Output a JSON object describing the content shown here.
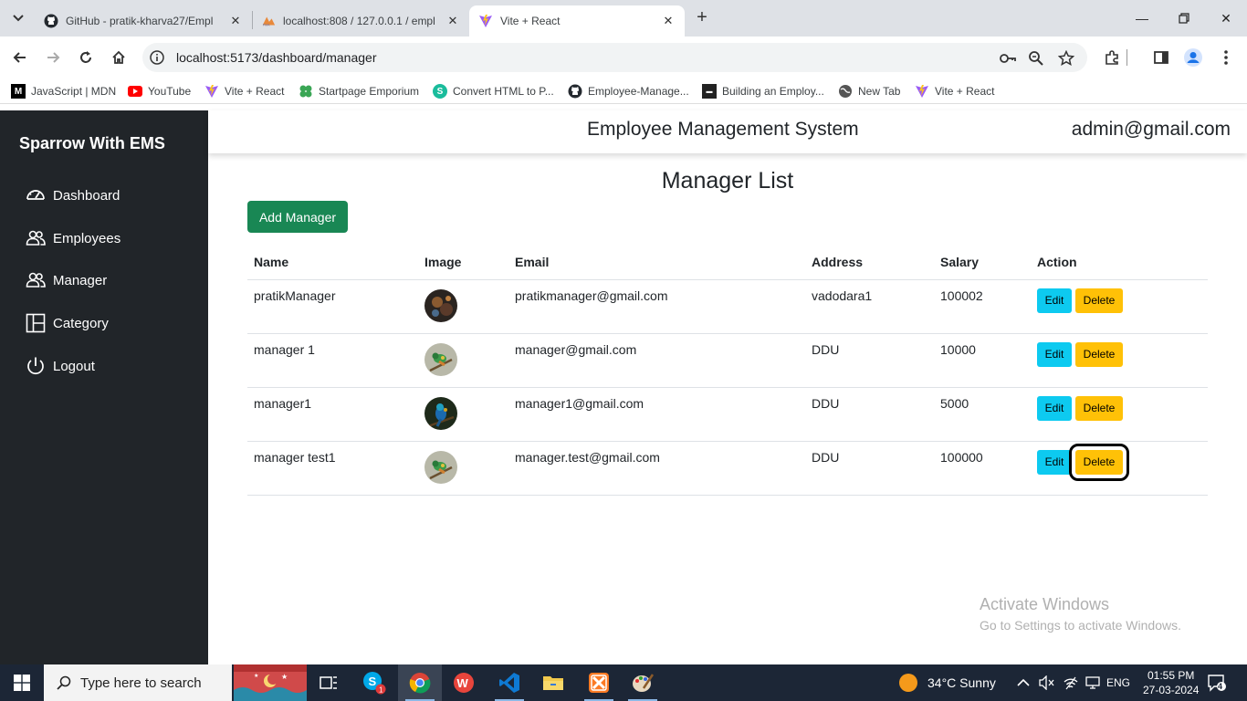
{
  "browser": {
    "tabs": [
      {
        "title": "GitHub - pratik-kharva27/Empl",
        "icon": "github-icon"
      },
      {
        "title": "localhost:808 / 127.0.0.1 / empl",
        "icon": "phpmyadmin-icon"
      },
      {
        "title": "Vite + React",
        "icon": "vite-icon",
        "active": true
      }
    ],
    "url": "localhost:5173/dashboard/manager",
    "bookmarks": [
      {
        "label": "JavaScript | MDN",
        "icon": "mdn-icon"
      },
      {
        "label": "YouTube",
        "icon": "youtube-icon"
      },
      {
        "label": "Vite + React",
        "icon": "vite-icon"
      },
      {
        "label": "Startpage Emporium",
        "icon": "clover-icon"
      },
      {
        "label": "Convert HTML to P...",
        "icon": "convert-icon"
      },
      {
        "label": "Employee-Manage...",
        "icon": "github-icon"
      },
      {
        "label": "Building an Employ...",
        "icon": "article-icon"
      },
      {
        "label": "New Tab",
        "icon": "globe-icon"
      },
      {
        "label": "Vite + React",
        "icon": "vite-icon"
      }
    ]
  },
  "sidebar": {
    "brand": "Sparrow With EMS",
    "items": [
      {
        "label": "Dashboard",
        "icon": "speedometer-icon"
      },
      {
        "label": "Employees",
        "icon": "people-icon"
      },
      {
        "label": "Manager",
        "icon": "people-icon"
      },
      {
        "label": "Category",
        "icon": "columns-icon"
      },
      {
        "label": "Logout",
        "icon": "power-icon"
      }
    ]
  },
  "header": {
    "title": "Employee Management System",
    "user": "admin@gmail.com"
  },
  "main": {
    "heading": "Manager List",
    "add_button": "Add Manager",
    "columns": [
      "Name",
      "Image",
      "Email",
      "Address",
      "Salary",
      "Action"
    ],
    "edit_label": "Edit",
    "delete_label": "Delete",
    "rows": [
      {
        "name": "pratikManager",
        "email": "pratikmanager@gmail.com",
        "address": "vadodara1",
        "salary": "100002",
        "avatar": "dark-photo"
      },
      {
        "name": "manager 1",
        "email": "manager@gmail.com",
        "address": "DDU",
        "salary": "10000",
        "avatar": "bird-photo"
      },
      {
        "name": "manager1",
        "email": "manager1@gmail.com",
        "address": "DDU",
        "salary": "5000",
        "avatar": "blue-bird-photo"
      },
      {
        "name": "manager test1",
        "email": "manager.test@gmail.com",
        "address": "DDU",
        "salary": "100000",
        "avatar": "bird-photo"
      }
    ]
  },
  "watermark": {
    "line1": "Activate Windows",
    "line2": "Go to Settings to activate Windows."
  },
  "taskbar": {
    "search_placeholder": "Type here to search",
    "weather": "34°C  Sunny",
    "language": "ENG",
    "time": "01:55 PM",
    "date": "27-03-2024",
    "notifications": "4"
  }
}
